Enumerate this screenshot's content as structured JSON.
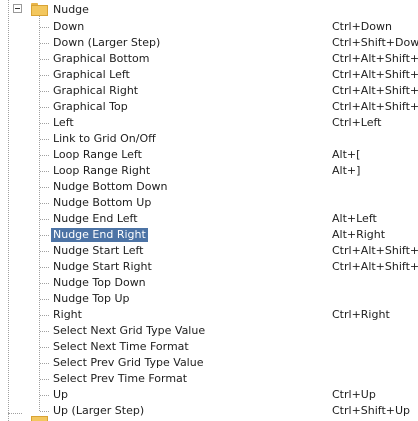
{
  "folder": {
    "label": "Nudge"
  },
  "rows": [
    {
      "name": "Down",
      "key": "Ctrl+Down"
    },
    {
      "name": "Down (Larger Step)",
      "key": "Ctrl+Shift+Down"
    },
    {
      "name": "Graphical Bottom",
      "key": "Ctrl+Alt+Shift+Do"
    },
    {
      "name": "Graphical Left",
      "key": "Ctrl+Alt+Shift+Le"
    },
    {
      "name": "Graphical Right",
      "key": "Ctrl+Alt+Shift+Rig"
    },
    {
      "name": "Graphical Top",
      "key": "Ctrl+Alt+Shift+Up"
    },
    {
      "name": "Left",
      "key": "Ctrl+Left"
    },
    {
      "name": "Link to Grid On/Off",
      "key": ""
    },
    {
      "name": "Loop Range Left",
      "key": "Alt+["
    },
    {
      "name": "Loop Range Right",
      "key": "Alt+]"
    },
    {
      "name": "Nudge Bottom Down",
      "key": ""
    },
    {
      "name": "Nudge Bottom Up",
      "key": ""
    },
    {
      "name": "Nudge End Left",
      "key": "Alt+Left"
    },
    {
      "name": "Nudge End Right",
      "key": "Alt+Right"
    },
    {
      "name": "Nudge Start Left",
      "key": "Ctrl+Alt+Shift+["
    },
    {
      "name": "Nudge Start Right",
      "key": "Ctrl+Alt+Shift+]"
    },
    {
      "name": "Nudge Top Down",
      "key": ""
    },
    {
      "name": "Nudge Top Up",
      "key": ""
    },
    {
      "name": "Right",
      "key": "Ctrl+Right"
    },
    {
      "name": "Select Next Grid Type Value",
      "key": ""
    },
    {
      "name": "Select Next Time Format",
      "key": ""
    },
    {
      "name": "Select Prev Grid Type Value",
      "key": ""
    },
    {
      "name": "Select Prev Time Format",
      "key": ""
    },
    {
      "name": "Up",
      "key": "Ctrl+Up"
    },
    {
      "name": "Up (Larger Step)",
      "key": "Ctrl+Shift+Up"
    }
  ],
  "selected": "Nudge End Right"
}
